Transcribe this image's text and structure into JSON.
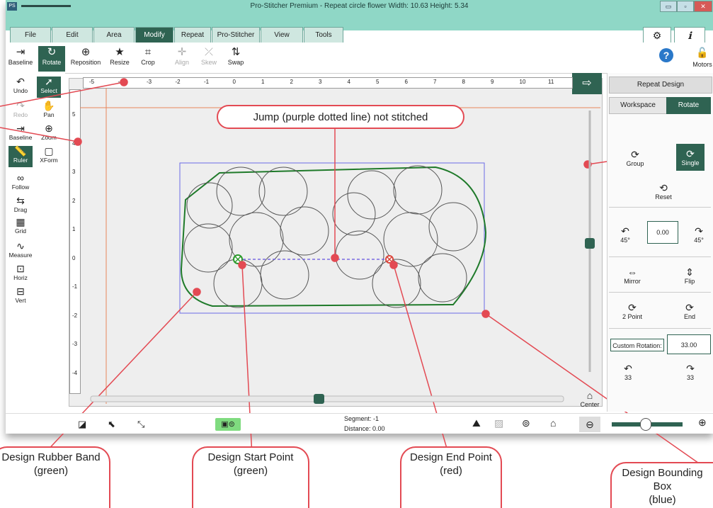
{
  "window": {
    "app_badge": "PS",
    "title": "Pro-Stitcher Premium   -   Repeat circle flower  Width: 10.63  Height: 5.34",
    "minimize": "▭",
    "maximize": "▫",
    "close": "✕"
  },
  "menu": {
    "tabs": [
      "File",
      "Edit",
      "Area",
      "Modify",
      "Repeat",
      "Pro-Stitcher",
      "View",
      "Tools"
    ],
    "active": "Modify",
    "settings_icon": "⚙",
    "info_icon": "ℹ"
  },
  "toolbar": {
    "items": [
      {
        "label": "Baseline",
        "icon": "⇥"
      },
      {
        "label": "Rotate",
        "icon": "↻"
      },
      {
        "label": "Reposition",
        "icon": "⊕"
      },
      {
        "label": "Resize",
        "icon": "★"
      },
      {
        "label": "Crop",
        "icon": "⌗"
      },
      {
        "label": "Align",
        "icon": "✛"
      },
      {
        "label": "Skew",
        "icon": "⤫"
      },
      {
        "label": "Swap",
        "icon": "⇅"
      }
    ],
    "help_icon": "?",
    "motors_label": "Motors",
    "motors_icon": "🔓"
  },
  "left_tools": [
    {
      "label": "Undo",
      "icon": "↶"
    },
    {
      "label": "Select",
      "icon": "➚"
    },
    {
      "label": "Redo",
      "icon": "↷"
    },
    {
      "label": "Pan",
      "icon": "✋"
    },
    {
      "label": "Baseline",
      "icon": "⇥"
    },
    {
      "label": "Zoom",
      "icon": "⊕"
    },
    {
      "label": "Ruler",
      "icon": "📏"
    },
    {
      "label": "XForm",
      "icon": "▢"
    },
    {
      "label": "Follow",
      "icon": "∞"
    },
    {
      "label": "Drag",
      "icon": "⇆"
    },
    {
      "label": "Grid",
      "icon": "▦"
    },
    {
      "label": "Measure",
      "icon": "∿"
    },
    {
      "label": "Horiz",
      "icon": "⊡"
    },
    {
      "label": "Vert",
      "icon": "⊟"
    }
  ],
  "ruler": {
    "h_ticks": [
      "-5",
      "-4",
      "-3",
      "-2",
      "-1",
      "0",
      "1",
      "2",
      "3",
      "4",
      "5",
      "6",
      "7",
      "8",
      "9",
      "10",
      "11"
    ],
    "v_ticks": [
      "5",
      "4",
      "3",
      "2",
      "1",
      "0",
      "-1",
      "-2",
      "-3",
      "-4"
    ]
  },
  "right_panel": {
    "repeat_design": "Repeat Design",
    "workspace_tab": "Workspace",
    "rotate_tab": "Rotate",
    "group": "Group",
    "single": "Single",
    "reset": "Reset",
    "rot_left_label": "45°",
    "rot_right_label": "45°",
    "rotation_value": "0.00",
    "mirror": "Mirror",
    "flip": "Flip",
    "two_point": "2 Point",
    "end": "End",
    "custom_rotation_label": "Custom Rotation:",
    "custom_rotation_value": "33.00",
    "rot33_left": "33",
    "rot33_right": "33",
    "center": "Center"
  },
  "status": {
    "segment_label": "Segment:",
    "segment_value": "-1",
    "distance_label": "Distance:",
    "distance_value": "0.00",
    "zoom_minus": "⊖",
    "zoom_plus": "⊕",
    "zoom_level": 0.12
  },
  "callouts": {
    "jump": "Jump (purple dotted line) not stitched",
    "rubber_band": "Design Rubber Band\n(green)",
    "start_point": "Design Start Point\n(green)",
    "end_point": "Design End Point\n(red)",
    "bounding": "Design Bounding Box\n(blue)"
  },
  "colors": {
    "accent": "#2f6352",
    "titlebar": "#8fd7c6",
    "callout_red": "#e34a53",
    "rubber_band_green": "#1f7a2a",
    "bounding_blue": "#6a6ae6",
    "jump_purple": "#7a6ae0",
    "end_red": "#d9463c"
  }
}
